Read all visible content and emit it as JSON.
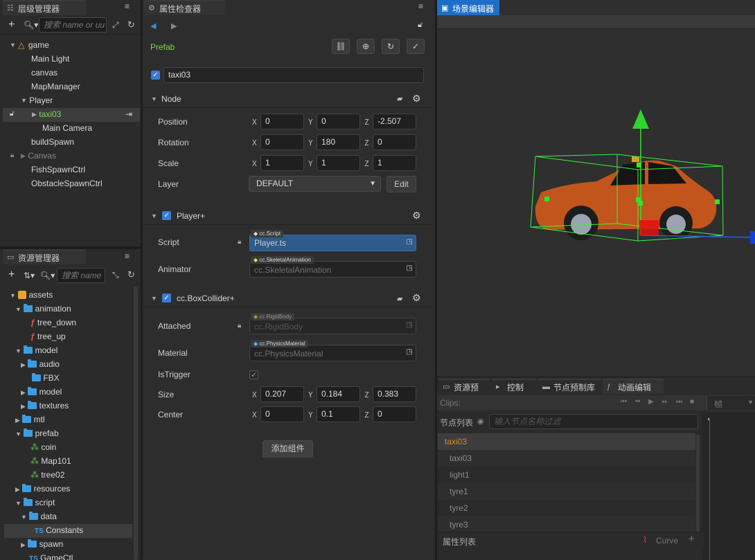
{
  "hierarchy": {
    "title": "层级管理器",
    "search_placeholder": "搜索 name or uu",
    "items": [
      {
        "label": "game",
        "depth": 0
      },
      {
        "label": "Main Light",
        "depth": 1
      },
      {
        "label": "canvas",
        "depth": 1
      },
      {
        "label": "MapManager",
        "depth": 1
      },
      {
        "label": "Player",
        "depth": 1
      },
      {
        "label": "taxi03",
        "depth": 2
      },
      {
        "label": "Main Camera",
        "depth": 2
      },
      {
        "label": "buildSpawn",
        "depth": 1
      },
      {
        "label": "Canvas",
        "depth": 1
      },
      {
        "label": "FishSpawnCtrl",
        "depth": 1
      },
      {
        "label": "ObstacleSpawnCtrl",
        "depth": 1
      }
    ]
  },
  "assets": {
    "title": "资源管理器",
    "search_placeholder": "搜索 name",
    "items": [
      {
        "label": "assets"
      },
      {
        "label": "animation"
      },
      {
        "label": "tree_down"
      },
      {
        "label": "tree_up"
      },
      {
        "label": "model"
      },
      {
        "label": "audio"
      },
      {
        "label": "FBX"
      },
      {
        "label": "model"
      },
      {
        "label": "textures"
      },
      {
        "label": "mtl"
      },
      {
        "label": "prefab"
      },
      {
        "label": "coin"
      },
      {
        "label": "Map101"
      },
      {
        "label": "tree02"
      },
      {
        "label": "resources"
      },
      {
        "label": "script"
      },
      {
        "label": "data"
      },
      {
        "label": "Constants",
        "ts": "TS"
      },
      {
        "label": "spawn"
      },
      {
        "label": "GameCtl",
        "ts": "TS"
      }
    ]
  },
  "inspector": {
    "title": "属性检查器",
    "prefab_label": "Prefab",
    "node_name": "taxi03",
    "node_section": "Node",
    "position": {
      "label": "Position",
      "x": "0",
      "y": "0",
      "z": "-2.507"
    },
    "rotation": {
      "label": "Rotation",
      "x": "0",
      "y": "180",
      "z": "0"
    },
    "scale": {
      "label": "Scale",
      "x": "1",
      "y": "1",
      "z": "1"
    },
    "layer": {
      "label": "Layer",
      "value": "DEFAULT",
      "edit": "Edit"
    },
    "axis_x": "X",
    "axis_y": "Y",
    "axis_z": "Z",
    "player_section": "Player+",
    "script": {
      "label": "Script",
      "tag": "cc.Script",
      "value": "Player.ts"
    },
    "animator": {
      "label": "Animator",
      "tag": "cc.SkeletalAnimation",
      "value": "cc.SkeletalAnimation"
    },
    "collider_section": "cc.BoxCollider+",
    "attached": {
      "label": "Attached",
      "tag": "cc.RigidBody",
      "value": "cc.RigidBody"
    },
    "material": {
      "label": "Material",
      "tag": "cc.PhysicsMaterial",
      "value": "cc.PhysicsMaterial"
    },
    "istrigger": {
      "label": "IsTrigger"
    },
    "size": {
      "label": "Size",
      "x": "0.207",
      "y": "0.184",
      "z": "0.383"
    },
    "center": {
      "label": "Center",
      "x": "0",
      "y": "0.1",
      "z": "0"
    },
    "add_component": "添加组件"
  },
  "scene": {
    "title": "场景编辑器"
  },
  "bottom_tabs": [
    "资源预览",
    "控制台",
    "节点预制库",
    "动画编辑器"
  ],
  "animation": {
    "clips_label": "Clips:",
    "frame_label": "帧",
    "node_list_label": "节点列表",
    "filter_placeholder": "输入节点名称过滤",
    "nodes": [
      "taxi03",
      "taxi03",
      "light1",
      "tyre1",
      "tyre2",
      "tyre3"
    ],
    "prop_list_label": "属性列表",
    "curve_label": "Curve"
  },
  "colors": {
    "accent": "#3a7bd5",
    "selected_text": "#7fd957",
    "tab_active": "#1b6fc9"
  }
}
